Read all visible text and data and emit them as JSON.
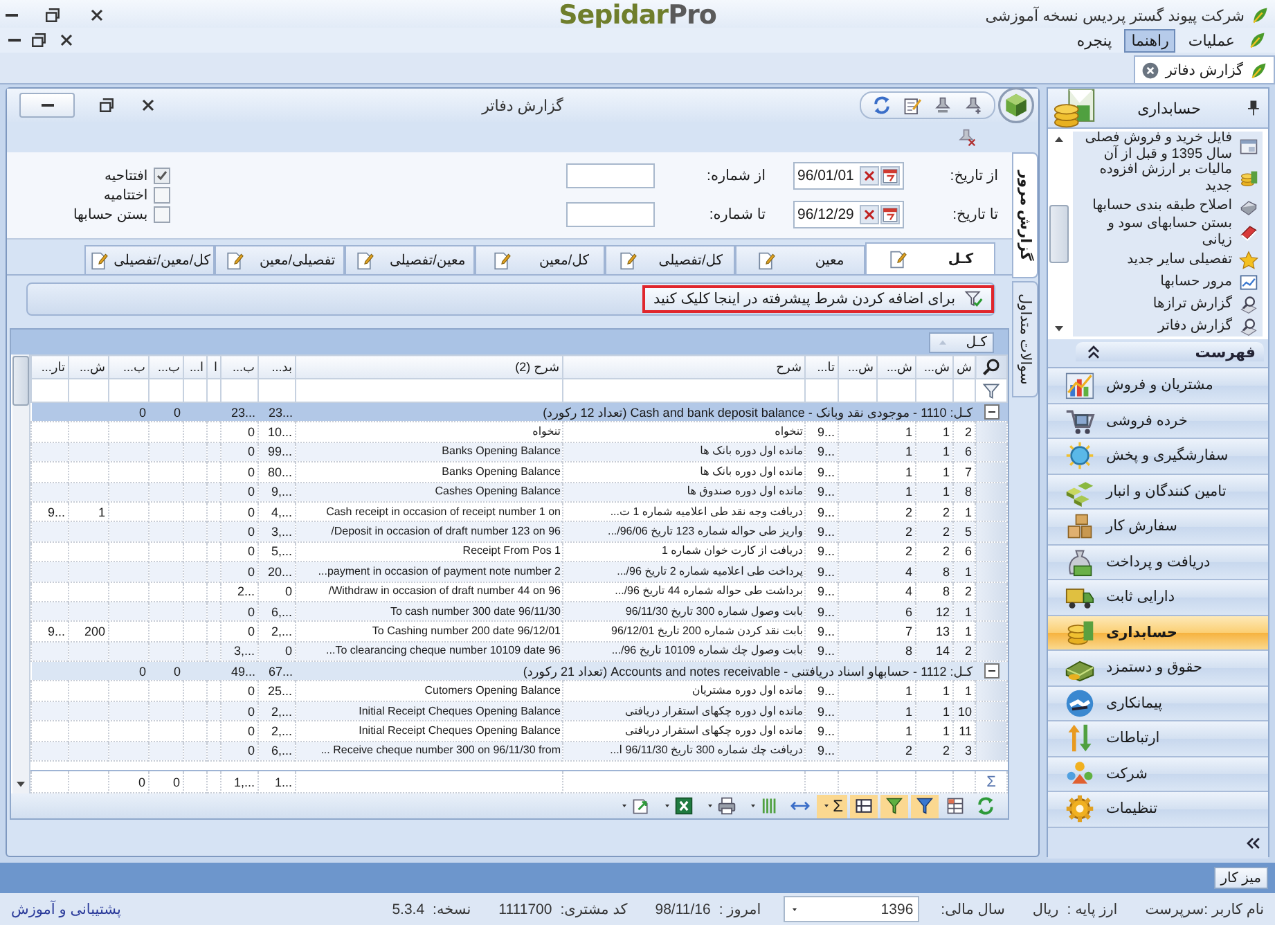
{
  "title_bar": {
    "company": "شرکت پیوند گستر پردیس نسخه آموزشی",
    "brand": {
      "name": "Sepidar",
      "suffix": "Pro"
    }
  },
  "menu": [
    {
      "label": "عملیات",
      "selected": false
    },
    {
      "label": "راهنما",
      "selected": true
    },
    {
      "label": "پنجره",
      "selected": false
    }
  ],
  "document_tabs": [
    {
      "label": "گزارش دفاتر"
    }
  ],
  "report_window": {
    "title": "گزارش دفاتر",
    "filters": {
      "from_date_label": "از تاریخ:",
      "from_date": "96/01/01",
      "to_date_label": "تا تاریخ:",
      "to_date": "96/12/29",
      "from_number_label": "از شماره:",
      "to_number_label": "تا شماره:"
    },
    "options": [
      {
        "label": "افتتاحیه",
        "checked": true
      },
      {
        "label": "اختتامیه",
        "checked": false
      },
      {
        "label": "بستن حسابها",
        "checked": false
      }
    ],
    "side_tabs": [
      {
        "label": "گزارش مرور",
        "selected": true
      },
      {
        "label": "سوالات متداول",
        "selected": false
      }
    ],
    "tabs": [
      {
        "label": "کـل",
        "selected": true
      },
      {
        "label": "معین",
        "selected": false
      },
      {
        "label": "کل/تفصیلی",
        "selected": false
      },
      {
        "label": "کل/معین",
        "selected": false
      },
      {
        "label": "معین/تفصیلی",
        "selected": false
      },
      {
        "label": "تفصیلی/معین",
        "selected": false
      },
      {
        "label": "کل/معین/تفصیلی",
        "selected": false
      }
    ],
    "advanced_filter": "برای اضافه کردن شرط پیشرفته در اینجا کلیک کنید",
    "grid": {
      "group_by": "کـل",
      "columns": [
        "ش",
        "ش...",
        "ش...",
        "ش...",
        "تا...",
        "شرح",
        "شرح (2)",
        "بد...",
        "ب...",
        "ا",
        "ا...",
        "ب...",
        "ب...",
        "ش...",
        "تار..."
      ],
      "groups": [
        {
          "label": "کـل: 1110 - موجودی نقد وبانک - Cash and bank deposit balance (تعداد 12 رکورد)",
          "expanded": true,
          "selected": true,
          "totals": {
            "column_8": "23...",
            "column_9": "23...",
            "column_12": "0",
            "column_13": "0"
          },
          "rows": [
            {
              "cells": [
                "2",
                "1",
                "1",
                null,
                "9...",
                "تنخواه",
                "تنخواه",
                "10...",
                "0",
                null,
                null,
                null,
                null,
                null,
                null
              ]
            },
            {
              "cells": [
                "6",
                "1",
                "1",
                null,
                "9...",
                "مانده اول دوره بانک ها",
                "Banks  Opening Balance",
                "99...",
                "0",
                null,
                null,
                null,
                null,
                null,
                null
              ]
            },
            {
              "cells": [
                "7",
                "1",
                "1",
                null,
                "9...",
                "مانده اول دوره بانک ها",
                "Banks  Opening Balance",
                "80...",
                "0",
                null,
                null,
                null,
                null,
                null,
                null
              ]
            },
            {
              "cells": [
                "8",
                "1",
                "1",
                null,
                "9...",
                "مانده اول دوره صندوق ها",
                "Cashes  Opening Balance",
                "9,...",
                "0",
                null,
                null,
                null,
                null,
                null,
                null
              ]
            },
            {
              "cells": [
                "1",
                "2",
                "2",
                null,
                "9...",
                "دریافت وجه نقد طی اعلامیه شماره 1 ت...",
                "Cash receipt in occasion of receipt number 1 on",
                "4,...",
                "0",
                null,
                null,
                null,
                null,
                "1",
                "9..."
              ]
            },
            {
              "cells": [
                "5",
                "2",
                "2",
                null,
                "9...",
                "واریز طی حواله شماره 123 تاریخ 96/06/...",
                "Deposit in occasion of draft number 123 on 96/",
                "3,...",
                "0",
                null,
                null,
                null,
                null,
                null,
                null
              ]
            },
            {
              "cells": [
                "6",
                "2",
                "2",
                null,
                "9...",
                "دریافت از کارت خوان شماره 1",
                "Receipt From Pos 1",
                "5,...",
                "0",
                null,
                null,
                null,
                null,
                null,
                null
              ]
            },
            {
              "cells": [
                "1",
                "8",
                "4",
                null,
                "9...",
                "پرداخت طی اعلامیه شماره 2 تاریخ 96/...",
                "payment in occasion of payment note number 2...",
                "20...",
                "0",
                null,
                null,
                null,
                null,
                null,
                null
              ]
            },
            {
              "cells": [
                "2",
                "8",
                "4",
                null,
                "9...",
                "برداشت طی حواله شماره 44 تاریخ 96/...",
                "Withdraw in occasion of draft number 44 on 96/",
                "0",
                "2...",
                null,
                null,
                null,
                null,
                null,
                null
              ]
            },
            {
              "cells": [
                "1",
                "12",
                "6",
                null,
                "9...",
                "بابت وصول شماره 300 تاریخ 96/11/30",
                "To cash number 300 date 96/11/30",
                "6,...",
                "0",
                null,
                null,
                null,
                null,
                null,
                null
              ]
            },
            {
              "cells": [
                "1",
                "13",
                "7",
                null,
                "9...",
                "بابت نقد کردن شماره 200 تاریخ 96/12/01",
                "To Cashing number 200 date 96/12/01",
                "2,...",
                "0",
                null,
                null,
                null,
                null,
                "200",
                "9..."
              ]
            },
            {
              "cells": [
                "2",
                "14",
                "8",
                null,
                "9...",
                "بابت وصول چك شماره 10109 تاريخ 96/...",
                "To clearancing cheque number 10109 date 96...",
                "0",
                "3,...",
                null,
                null,
                null,
                null,
                null,
                null
              ]
            }
          ]
        },
        {
          "label": "کـل: 1112 - حسابهاو اسناد دریافتنی - Accounts and notes receivable (تعداد 21 رکورد)",
          "expanded": true,
          "selected": false,
          "totals": {
            "column_8": "67...",
            "column_9": "49...",
            "column_12": "0",
            "column_13": "0"
          },
          "rows": [
            {
              "cells": [
                "1",
                "1",
                "1",
                null,
                "9...",
                "مانده اول دوره مشتریان",
                "Cutomers Opening Balance",
                "25...",
                "0",
                null,
                null,
                null,
                null,
                null,
                null
              ]
            },
            {
              "cells": [
                "10",
                "1",
                "1",
                null,
                "9...",
                "مانده اول دوره چکهای استقرار دریافتی",
                "Initial Receipt Cheques Opening Balance",
                "2,...",
                "0",
                null,
                null,
                null,
                null,
                null,
                null
              ]
            },
            {
              "cells": [
                "11",
                "1",
                "1",
                null,
                "9...",
                "مانده اول دوره چکهای استقرار دریافتی",
                "Initial Receipt Cheques Opening Balance",
                "2,...",
                "0",
                null,
                null,
                null,
                null,
                null,
                null
              ]
            },
            {
              "cells": [
                "3",
                "2",
                "2",
                null,
                "9...",
                "دریافت چك شماره 300 تاریخ 96/11/30 ا...",
                "Receive cheque number 300 on 96/11/30 from ...",
                "6,...",
                "0",
                null,
                null,
                null,
                null,
                null,
                null
              ]
            }
          ]
        }
      ],
      "footer": {
        "symbol": "Σ",
        "cells": [
          null,
          null,
          null,
          null,
          null,
          null,
          null,
          "1...",
          "1,...",
          null,
          null,
          "0",
          "0",
          null,
          null
        ]
      }
    },
    "toolbar": [
      {
        "on": false
      },
      {
        "on": false
      },
      {
        "on": true
      },
      {
        "on": true
      },
      {
        "on": true
      },
      {
        "on": true,
        "label": "Σ"
      },
      {
        "on": false
      },
      {
        "on": false
      },
      {
        "on": false
      },
      {
        "on": false
      },
      {
        "on": false
      }
    ]
  },
  "sidebar": {
    "title": "حسابداری",
    "tasks": [
      {
        "label": "فایل خرید و فروش فصلی سال 1395 و قبل از آن"
      },
      {
        "label": "مالیات بر ارزش افزوده جدید"
      },
      {
        "label": "اصلاح طبقه بندی حسابها"
      },
      {
        "label": "بستن حسابهای سود و زیانی"
      },
      {
        "label": "تفصیلی سایر جدید"
      },
      {
        "label": "مرور حسابها"
      },
      {
        "label": "گزارش ترازها"
      },
      {
        "label": "گزارش دفاتر"
      }
    ],
    "list_header": "فهرست",
    "modules": [
      {
        "label": "مشتریان و فروش",
        "selected": false
      },
      {
        "label": "خرده فروشی",
        "selected": false
      },
      {
        "label": "سفارشگیری و پخش",
        "selected": false
      },
      {
        "label": "تامین کنندگان و انبار",
        "selected": false
      },
      {
        "label": "سفارش کار",
        "selected": false
      },
      {
        "label": "دریافت و پرداخت",
        "selected": false
      },
      {
        "label": "دارایی ثابت",
        "selected": false
      },
      {
        "label": "حسابداری",
        "selected": true
      },
      {
        "label": "حقوق و دستمزد",
        "selected": false
      },
      {
        "label": "پیمانکاری",
        "selected": false
      },
      {
        "label": "ارتباطات",
        "selected": false
      },
      {
        "label": "شرکت",
        "selected": false
      },
      {
        "label": "تنظیمات",
        "selected": false
      }
    ]
  },
  "taskbar": [
    {
      "label": "میز کار"
    }
  ],
  "status_bar": {
    "user": "نام کاربر :سرپرست",
    "currency_label": "ارز پایه :",
    "currency": "ریال",
    "year_label": "سال مالی:",
    "year": "1396",
    "today_label": "امروز :",
    "today": "98/11/16",
    "customer_code_label": "کد مشتری:",
    "customer_code": "1111700",
    "version_label": "نسخه:",
    "version": "5.3.4",
    "support_link": "پشتیبانی و آموزش"
  }
}
